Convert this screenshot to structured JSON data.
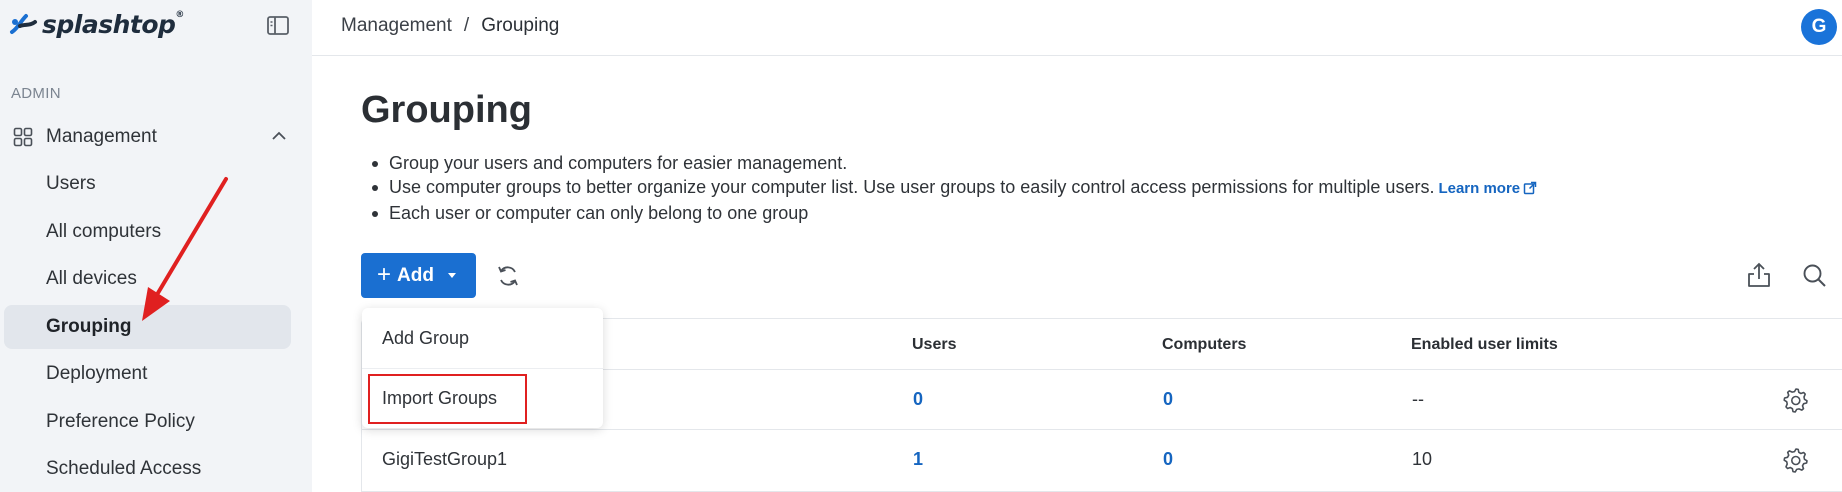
{
  "app": {
    "logo_text": "splashtop",
    "logo_mark": "®"
  },
  "sidebar": {
    "section_label": "ADMIN",
    "group": {
      "label": "Management"
    },
    "items": [
      {
        "label": "Users"
      },
      {
        "label": "All computers"
      },
      {
        "label": "All devices"
      },
      {
        "label": "Grouping",
        "active": true
      },
      {
        "label": "Deployment"
      },
      {
        "label": "Preference Policy"
      },
      {
        "label": "Scheduled Access"
      }
    ]
  },
  "breadcrumb": {
    "parent": "Management",
    "separator": "/",
    "current": "Grouping"
  },
  "user": {
    "avatar_initial": "G",
    "avatar_color": "#1a73d9"
  },
  "page": {
    "title": "Grouping",
    "bullets": [
      "Group your users and computers for easier management.",
      "Use computer groups to better organize your computer list. Use user groups to easily control access permissions for multiple users.",
      "Each user or computer can only belong to one group"
    ],
    "learn_more": "Learn more"
  },
  "toolbar": {
    "add_label": "Add"
  },
  "dropdown": {
    "items": [
      "Add Group",
      "Import Groups"
    ]
  },
  "table": {
    "headers": {
      "users": "Users",
      "computers": "Computers",
      "limits": "Enabled user limits"
    },
    "rows": [
      {
        "name": "",
        "users": "0",
        "computers": "0",
        "limits": "--"
      },
      {
        "name": "GigiTestGroup1",
        "users": "1",
        "computers": "0",
        "limits": "10"
      }
    ]
  },
  "colors": {
    "accent": "#1a6fd1",
    "link": "#1565c0",
    "annotation": "#e02020"
  },
  "icons": [
    "sidebar-toggle-icon",
    "grid-icon",
    "chevron-up-icon",
    "plus-icon",
    "caret-down-icon",
    "refresh-icon",
    "export-icon",
    "search-icon",
    "gear-icon",
    "external-link-icon"
  ]
}
